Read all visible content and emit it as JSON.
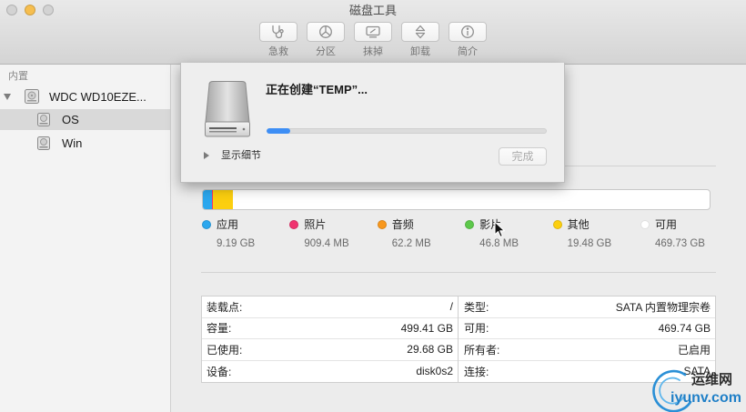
{
  "window": {
    "title": "磁盘工具",
    "traffic_lights": {
      "close_color": "#d3d3d3",
      "minimize_color": "#f6be4f",
      "zoom_color": "#d3d3d3"
    }
  },
  "toolbar": {
    "buttons": [
      {
        "label": "急救",
        "icon": "stethoscope-icon"
      },
      {
        "label": "分区",
        "icon": "partition-pie-icon"
      },
      {
        "label": "抹掉",
        "icon": "erase-icon"
      },
      {
        "label": "卸载",
        "icon": "unmount-icon"
      },
      {
        "label": "简介",
        "icon": "info-icon"
      }
    ]
  },
  "sidebar": {
    "section_header": "内置",
    "disk": {
      "name": "WDC WD10EZE...",
      "icon": "hard-disk-icon",
      "expanded": true
    },
    "volumes": [
      {
        "name": "OS",
        "icon": "volume-icon",
        "selected": true
      },
      {
        "name": "Win",
        "icon": "volume-icon",
        "selected": false
      }
    ],
    "selection_color": "#d9d9d9"
  },
  "sheet": {
    "title": "正在创建“TEMP”...",
    "icon": "external-drive-icon",
    "progress": 0.085,
    "progress_color": "#3d8ef5",
    "details_toggle_label": "显示细节",
    "done_button_label": "完成",
    "done_button_enabled": false
  },
  "storage": {
    "categories": [
      {
        "label": "应用",
        "value": "9.19 GB",
        "color": "#2ba7ee"
      },
      {
        "label": "照片",
        "value": "909.4 MB",
        "color": "#f0336f"
      },
      {
        "label": "音频",
        "value": "62.2 MB",
        "color": "#f8981d"
      },
      {
        "label": "影片",
        "value": "46.8 MB",
        "color": "#5dc84b"
      },
      {
        "label": "其他",
        "value": "19.48 GB",
        "color": "#fccf0f"
      },
      {
        "label": "可用",
        "value": "469.73 GB",
        "color": "#ffffff"
      }
    ]
  },
  "info": {
    "left": [
      {
        "label": "装载点:",
        "value": "/"
      },
      {
        "label": "容量:",
        "value": "499.41 GB"
      },
      {
        "label": "已使用:",
        "value": "29.68 GB"
      },
      {
        "label": "设备:",
        "value": "disk0s2"
      }
    ],
    "right": [
      {
        "label": "类型:",
        "value": "SATA 内置物理宗卷"
      },
      {
        "label": "可用:",
        "value": "469.74 GB"
      },
      {
        "label": "所有者:",
        "value": "已启用"
      },
      {
        "label": "连接:",
        "value": "SATA"
      }
    ]
  },
  "watermark": {
    "site_name": "运维网",
    "domain": "iyunv.com"
  }
}
